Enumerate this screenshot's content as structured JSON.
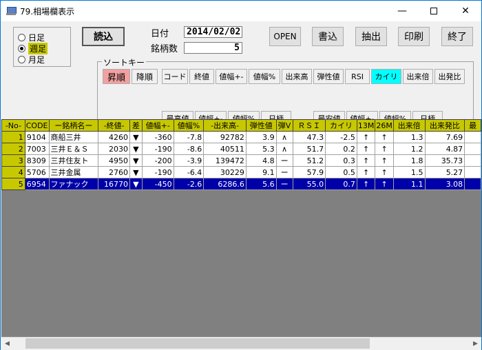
{
  "window": {
    "title": "79.相場欄表示"
  },
  "period": {
    "options": [
      {
        "label": "日足",
        "selected": false
      },
      {
        "label": "週足",
        "selected": true
      },
      {
        "label": "月足",
        "selected": false
      }
    ]
  },
  "toolbar": {
    "load_label": "読込",
    "date_label": "日付",
    "date_value": "2014/02/02",
    "count_label": "銘柄数",
    "count_value": "5",
    "open_label": "OPEN",
    "write_label": "書込",
    "extract_label": "抽出",
    "print_label": "印刷",
    "exit_label": "終了"
  },
  "sort": {
    "legend": "ソートキー",
    "asc_label": "昇順",
    "desc_label": "降順",
    "row1": [
      "コード",
      "終値",
      "値幅+-",
      "値幅%",
      "出来高",
      "弾性値",
      "RSI",
      "カイリ",
      "出来倍",
      "出発比"
    ],
    "high_group": [
      "最高値",
      "値幅+-",
      "値幅%",
      "日柄"
    ],
    "low_group": [
      "最安値",
      "値幅+-",
      "値幅%",
      "日柄"
    ],
    "active_key": "カイリ"
  },
  "table": {
    "headers": [
      "-No-",
      "CODE",
      "ー銘柄名ー",
      "-終値-",
      "差",
      "値幅+-",
      "値幅%",
      "-出来高-",
      "弾性値",
      "弾V",
      "ＲＳＩ",
      "カイリ",
      "13M",
      "26M",
      "出来倍",
      "出来発比",
      "最"
    ],
    "rows": [
      [
        "1",
        "9104",
        "商船三井",
        "4260",
        "▼",
        "-360",
        "-7.8",
        "92782",
        "3.9",
        "∧",
        "47.3",
        "-2.5",
        "↑",
        "↑",
        "1.3",
        "7.69",
        ""
      ],
      [
        "2",
        "7003",
        "三井Ｅ＆Ｓ",
        "2030",
        "▼",
        "-190",
        "-8.6",
        "40511",
        "5.3",
        "∧",
        "51.7",
        "0.2",
        "↑",
        "↑",
        "1.2",
        "4.87",
        ""
      ],
      [
        "3",
        "8309",
        "三井住友ト",
        "4950",
        "▼",
        "-200",
        "-3.9",
        "139472",
        "4.8",
        "ー",
        "51.2",
        "0.3",
        "↑",
        "↑",
        "1.8",
        "35.73",
        ""
      ],
      [
        "4",
        "5706",
        "三井金属",
        "2760",
        "▼",
        "-190",
        "-6.4",
        "30229",
        "9.1",
        "ー",
        "57.9",
        "0.5",
        "↑",
        "↑",
        "1.5",
        "5.27",
        ""
      ],
      [
        "5",
        "6954",
        "ファナック",
        "16770",
        "▼",
        "-450",
        "-2.6",
        "6286.6",
        "5.6",
        "ー",
        "55.0",
        "0.7",
        "↑",
        "↑",
        "1.1",
        "3.08",
        ""
      ]
    ],
    "selected_row": 4
  },
  "colors": {
    "header": "#c8c800",
    "selection": "#0000a8",
    "asc": "#f2a0a0",
    "active_key": "#00ffff"
  }
}
